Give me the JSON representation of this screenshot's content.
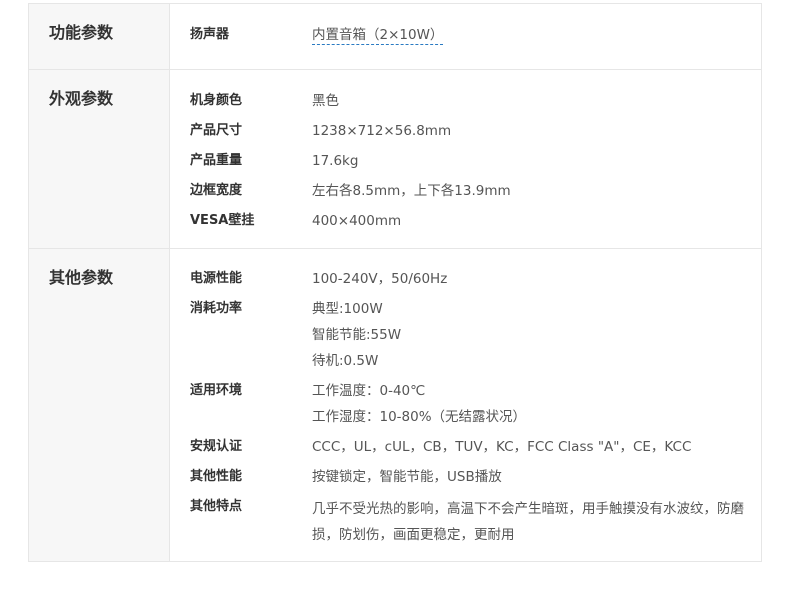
{
  "sections": [
    {
      "title": "功能参数",
      "rows": [
        {
          "label": "扬声器",
          "values": [
            "内置音箱（2×10W）"
          ]
        }
      ]
    },
    {
      "title": "外观参数",
      "rows": [
        {
          "label": "机身颜色",
          "values": [
            "黑色"
          ]
        },
        {
          "label": "产品尺寸",
          "values": [
            "1238×712×56.8mm"
          ]
        },
        {
          "label": "产品重量",
          "values": [
            "17.6kg"
          ]
        },
        {
          "label": "边框宽度",
          "values": [
            "左右各8.5mm，上下各13.9mm"
          ]
        },
        {
          "label": "VESA壁挂",
          "values": [
            "400×400mm"
          ]
        }
      ]
    },
    {
      "title": "其他参数",
      "rows": [
        {
          "label": "电源性能",
          "values": [
            "100-240V，50/60Hz"
          ]
        },
        {
          "label": "消耗功率",
          "values": [
            "典型:100W",
            "智能节能:55W",
            "待机:0.5W"
          ]
        },
        {
          "label": "适用环境",
          "values": [
            "工作温度：0-40℃",
            "工作湿度：10-80%（无结露状况）"
          ]
        },
        {
          "label": "安规认证",
          "values": [
            "CCC，UL，cUL，CB，TUV，KC，FCC Class \"A\"，CE，KCC"
          ]
        },
        {
          "label": "其他性能",
          "values": [
            "按键锁定，智能节能，USB播放"
          ]
        },
        {
          "label": "其他特点",
          "values": [
            "几乎不受光热的影响，高温下不会产生暗斑，用手触摸没有水波纹，防磨损，防划伤，画面更稳定，更耐用"
          ]
        }
      ]
    }
  ]
}
